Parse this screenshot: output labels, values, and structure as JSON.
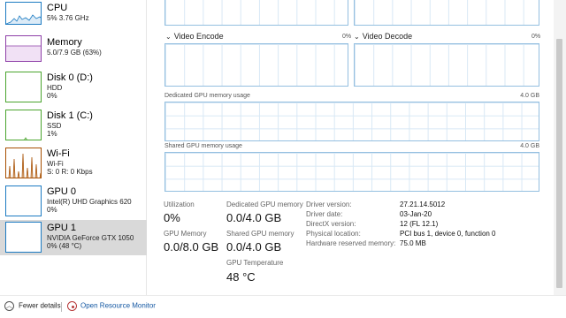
{
  "colors": {
    "cpu": "#1c7bc2",
    "memory": "#8e3fa8",
    "disk": "#4aa52e",
    "wifi": "#a74f01",
    "gpu": "#1c7bc2",
    "graph_border": "#94bfe0",
    "selected_bg": "#d9d9d9",
    "link": "#1458a3"
  },
  "sidebar": {
    "items": [
      {
        "title": "CPU",
        "sub1": "5%  3.76 GHz",
        "sub2": ""
      },
      {
        "title": "Memory",
        "sub1": "5.0/7.9 GB (63%)",
        "sub2": ""
      },
      {
        "title": "Disk 0 (D:)",
        "sub1": "HDD",
        "sub2": "0%"
      },
      {
        "title": "Disk 1 (C:)",
        "sub1": "SSD",
        "sub2": "1%"
      },
      {
        "title": "Wi-Fi",
        "sub1": "Wi-Fi",
        "sub2": "S: 0  R: 0 Kbps"
      },
      {
        "title": "GPU 0",
        "sub1": "Intel(R) UHD Graphics 620",
        "sub2": "0%"
      },
      {
        "title": "GPU 1",
        "sub1": "NVIDIA GeForce GTX 1050",
        "sub2": "0%  (48 °C)"
      }
    ],
    "selected_index": 6
  },
  "engines": {
    "video_encode": {
      "label": "Video Encode",
      "percent": "0%"
    },
    "video_decode": {
      "label": "Video Decode",
      "percent": "0%"
    }
  },
  "memory_graphs": {
    "dedicated": {
      "label": "Dedicated GPU memory usage",
      "max": "4.0 GB"
    },
    "shared": {
      "label": "Shared GPU memory usage",
      "max": "4.0 GB"
    }
  },
  "stats": {
    "utilization": {
      "label": "Utilization",
      "value": "0%"
    },
    "gpu_memory": {
      "label": "GPU Memory",
      "value": "0.0/8.0 GB"
    },
    "dedicated_memory": {
      "label": "Dedicated GPU memory",
      "value": "0.0/4.0 GB"
    },
    "shared_memory": {
      "label": "Shared GPU memory",
      "value": "0.0/4.0 GB"
    },
    "temperature": {
      "label": "GPU Temperature",
      "value": "48 °C"
    }
  },
  "details": [
    {
      "key": "Driver version:",
      "value": "27.21.14.5012"
    },
    {
      "key": "Driver date:",
      "value": "03-Jan-20"
    },
    {
      "key": "DirectX version:",
      "value": "12 (FL 12.1)"
    },
    {
      "key": "Physical location:",
      "value": "PCI bus 1, device 0, function 0"
    },
    {
      "key": "Hardware reserved memory:",
      "value": "75.0 MB"
    }
  ],
  "footer": {
    "fewer_details": "Fewer details",
    "open_resource_monitor": "Open Resource Monitor"
  }
}
